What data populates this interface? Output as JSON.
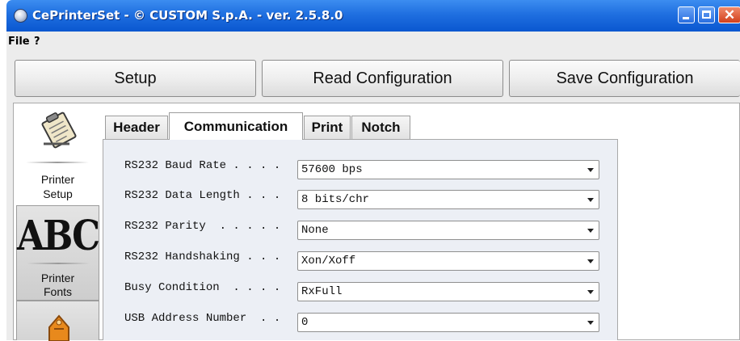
{
  "window": {
    "title": "CePrinterSet - © CUSTOM S.p.A. - ver. 2.5.8.0"
  },
  "menu": {
    "items": [
      "File",
      "?"
    ]
  },
  "toolbar": {
    "setup_label": "Setup",
    "read_label": "Read Configuration",
    "save_label": "Save Configuration"
  },
  "sidebar": {
    "items": [
      {
        "label_line1": "Printer",
        "label_line2": "Setup",
        "icon": "clipboard-icon"
      },
      {
        "label_line1": "Printer",
        "label_line2": "Fonts",
        "icon": "abc-fonts-icon",
        "icon_text": "ABC"
      },
      {
        "icon": "toolbox-icon"
      }
    ]
  },
  "tabs": [
    {
      "label": "Header"
    },
    {
      "label": "Communication",
      "active": true
    },
    {
      "label": "Print"
    },
    {
      "label": "Notch"
    }
  ],
  "settings": [
    {
      "label": "RS232 Baud Rate . . . .",
      "value": "57600 bps"
    },
    {
      "label": "RS232 Data Length . . .",
      "value": "8 bits/chr"
    },
    {
      "label": "RS232 Parity  . . . . .",
      "value": "None"
    },
    {
      "label": "RS232 Handshaking . . .",
      "value": "Xon/Xoff"
    },
    {
      "label": "Busy Condition  . . . .",
      "value": "RxFull"
    },
    {
      "label": "USB Address Number  . .",
      "value": "0"
    }
  ],
  "colors": {
    "titlebar": "#1f6fe0",
    "panel": "#eceff5",
    "background": "#ececec"
  }
}
